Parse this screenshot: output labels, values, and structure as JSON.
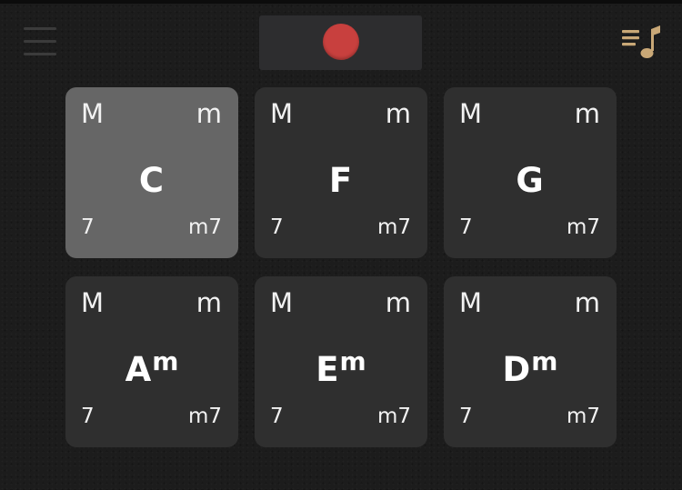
{
  "colors": {
    "background": "#1c1c1c",
    "pad": "#2f2f2f",
    "pad_active": "#666666",
    "record_panel": "#2d2d2f",
    "record_dot": "#c8403e",
    "accent": "#c9a877"
  },
  "icons": {
    "menu": "menu-icon",
    "record": "record-icon",
    "playlist": "music-playlist-icon"
  },
  "pads": [
    {
      "root": "C",
      "quality": "",
      "top_left": "M",
      "top_right": "m",
      "bottom_left": "7",
      "bottom_right": "m7",
      "active": true
    },
    {
      "root": "F",
      "quality": "",
      "top_left": "M",
      "top_right": "m",
      "bottom_left": "7",
      "bottom_right": "m7",
      "active": false
    },
    {
      "root": "G",
      "quality": "",
      "top_left": "M",
      "top_right": "m",
      "bottom_left": "7",
      "bottom_right": "m7",
      "active": false
    },
    {
      "root": "A",
      "quality": "m",
      "top_left": "M",
      "top_right": "m",
      "bottom_left": "7",
      "bottom_right": "m7",
      "active": false
    },
    {
      "root": "E",
      "quality": "m",
      "top_left": "M",
      "top_right": "m",
      "bottom_left": "7",
      "bottom_right": "m7",
      "active": false
    },
    {
      "root": "D",
      "quality": "m",
      "top_left": "M",
      "top_right": "m",
      "bottom_left": "7",
      "bottom_right": "m7",
      "active": false
    }
  ]
}
